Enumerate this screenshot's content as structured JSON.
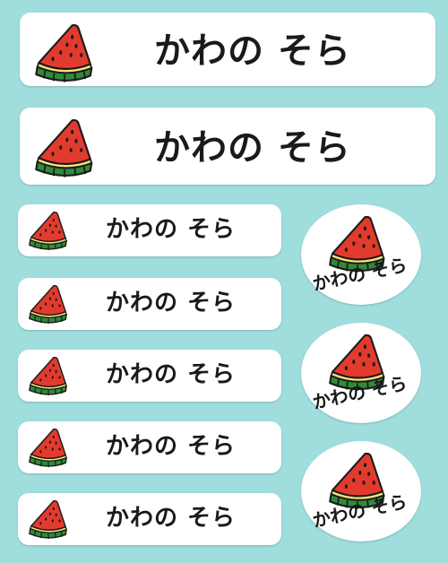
{
  "sheet": {
    "background_color": "#9fdedd",
    "label_text": "かわの そら",
    "icon": "watermelon-slice-icon",
    "colors": {
      "flesh": "#e23b2e",
      "rind_light": "#f5e27a",
      "rind_green": "#2f8a3a",
      "seed": "#1a1a1a",
      "text": "#1a1a1a"
    }
  },
  "big_labels": [
    {
      "text": "かわの そら"
    },
    {
      "text": "かわの そら"
    }
  ],
  "small_labels": [
    {
      "text": "かわの そら"
    },
    {
      "text": "かわの そら"
    },
    {
      "text": "かわの そら"
    },
    {
      "text": "かわの そら"
    },
    {
      "text": "かわの そら"
    }
  ],
  "oval_labels": [
    {
      "text": "かわの そら"
    },
    {
      "text": "かわの そら"
    },
    {
      "text": "かわの そら"
    }
  ]
}
